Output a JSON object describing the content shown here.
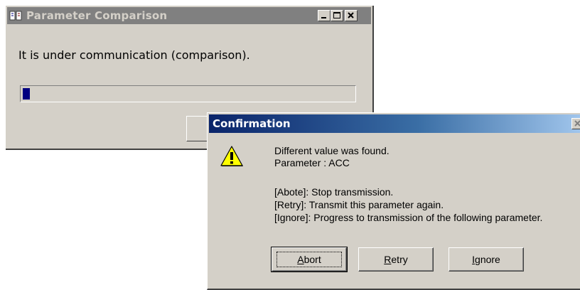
{
  "back_window": {
    "title": "Parameter Comparison",
    "message": "It is under communication (comparison).",
    "progress": 0.02
  },
  "dialog": {
    "title": "Confirmation",
    "line1": "Different value was found.",
    "line2": "Parameter : ACC",
    "line3": "[Abote]: Stop transmission.",
    "line4": "[Retry]: Transmit this parameter again.",
    "line5": "[Ignore]: Progress to transmission of the following parameter.",
    "buttons": {
      "abort": {
        "accel": "A",
        "rest": "bort"
      },
      "retry": {
        "accel": "R",
        "rest": "etry"
      },
      "ignore": {
        "accel": "I",
        "rest": "gnore"
      }
    }
  },
  "colors": {
    "title_active_start": "#0a246a",
    "title_active_end": "#a6caf0",
    "title_inactive": "#808080",
    "progress": "#000080",
    "face": "#d4d0c8"
  }
}
